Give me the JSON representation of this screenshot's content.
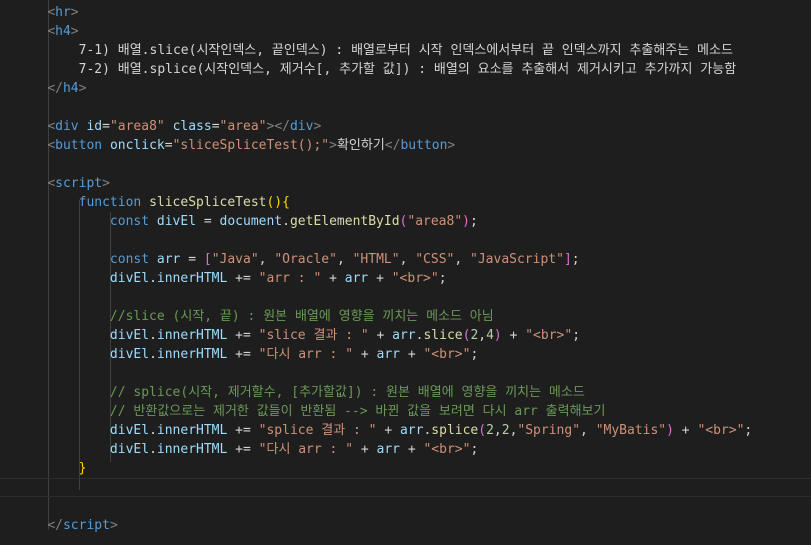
{
  "editor": {
    "colors": {
      "background": "#1e1e1e",
      "tag": "#569cd6",
      "punctuation": "#808080",
      "attribute": "#9cdcfe",
      "string": "#ce9178",
      "text": "#d4d4d4",
      "keyword": "#569cd6",
      "function": "#dcdcaa",
      "variable": "#9cdcfe",
      "number": "#b5cea8",
      "comment": "#6a9955",
      "brace": "#ffd700"
    },
    "lines": [
      {
        "indent": "    ",
        "tokens": [
          [
            "punc",
            "<"
          ],
          [
            "tag",
            "hr"
          ],
          [
            "punc",
            ">"
          ]
        ]
      },
      {
        "indent": "    ",
        "tokens": [
          [
            "punc",
            "<"
          ],
          [
            "tag",
            "h4"
          ],
          [
            "punc",
            ">"
          ]
        ]
      },
      {
        "indent": "        ",
        "tokens": [
          [
            "txt",
            "7-1) 배열.slice(시작인덱스, 끝인덱스) : 배열로부터 시작 인덱스에서부터 끝 인덱스까지 추출해주는 메소드"
          ]
        ]
      },
      {
        "indent": "        ",
        "tokens": [
          [
            "txt",
            "7-2) 배열.splice(시작인덱스, 제거수[, 추가할 값]) : 배열의 요소를 추출해서 제거시키고 추가까지 가능함"
          ]
        ]
      },
      {
        "indent": "    ",
        "tokens": [
          [
            "punc",
            "</"
          ],
          [
            "tag",
            "h4"
          ],
          [
            "punc",
            ">"
          ]
        ]
      },
      {
        "indent": "",
        "tokens": []
      },
      {
        "indent": "    ",
        "tokens": [
          [
            "punc",
            "<"
          ],
          [
            "tag",
            "div"
          ],
          [
            "txt",
            " "
          ],
          [
            "attr",
            "id"
          ],
          [
            "txt",
            "="
          ],
          [
            "str",
            "\"area8\""
          ],
          [
            "txt",
            " "
          ],
          [
            "attr",
            "class"
          ],
          [
            "txt",
            "="
          ],
          [
            "str",
            "\"area\""
          ],
          [
            "punc",
            "></"
          ],
          [
            "tag",
            "div"
          ],
          [
            "punc",
            ">"
          ]
        ]
      },
      {
        "indent": "    ",
        "tokens": [
          [
            "punc",
            "<"
          ],
          [
            "tag",
            "button"
          ],
          [
            "txt",
            " "
          ],
          [
            "attr",
            "onclick"
          ],
          [
            "txt",
            "="
          ],
          [
            "str",
            "\"sliceSpliceTest();\""
          ],
          [
            "punc",
            ">"
          ],
          [
            "txt",
            "확인하기"
          ],
          [
            "punc",
            "</"
          ],
          [
            "tag",
            "button"
          ],
          [
            "punc",
            ">"
          ]
        ]
      },
      {
        "indent": "",
        "tokens": []
      },
      {
        "indent": "    ",
        "tokens": [
          [
            "punc",
            "<"
          ],
          [
            "tag",
            "script"
          ],
          [
            "punc",
            ">"
          ]
        ]
      },
      {
        "indent": "        ",
        "tokens": [
          [
            "kw",
            "function"
          ],
          [
            "txt",
            " "
          ],
          [
            "fn",
            "sliceSpliceTest"
          ],
          [
            "brace",
            "()"
          ],
          [
            "brace",
            "{"
          ]
        ]
      },
      {
        "indent": "            ",
        "tokens": [
          [
            "kw",
            "const"
          ],
          [
            "txt",
            " "
          ],
          [
            "var",
            "divEl"
          ],
          [
            "op",
            " = "
          ],
          [
            "var",
            "document"
          ],
          [
            "op",
            "."
          ],
          [
            "fn",
            "getElementById"
          ],
          [
            "paren",
            "("
          ],
          [
            "str",
            "\"area8\""
          ],
          [
            "paren",
            ")"
          ],
          [
            "op",
            ";"
          ]
        ]
      },
      {
        "indent": "",
        "tokens": []
      },
      {
        "indent": "            ",
        "tokens": [
          [
            "kw",
            "const"
          ],
          [
            "txt",
            " "
          ],
          [
            "var",
            "arr"
          ],
          [
            "op",
            " = "
          ],
          [
            "paren",
            "["
          ],
          [
            "str",
            "\"Java\""
          ],
          [
            "op",
            ", "
          ],
          [
            "str",
            "\"Oracle\""
          ],
          [
            "op",
            ", "
          ],
          [
            "str",
            "\"HTML\""
          ],
          [
            "op",
            ", "
          ],
          [
            "str",
            "\"CSS\""
          ],
          [
            "op",
            ", "
          ],
          [
            "str",
            "\"JavaScript\""
          ],
          [
            "paren",
            "]"
          ],
          [
            "op",
            ";"
          ]
        ]
      },
      {
        "indent": "            ",
        "tokens": [
          [
            "var",
            "divEl"
          ],
          [
            "op",
            "."
          ],
          [
            "var",
            "innerHTML"
          ],
          [
            "op",
            " += "
          ],
          [
            "str",
            "\"arr : \""
          ],
          [
            "op",
            " + "
          ],
          [
            "var",
            "arr"
          ],
          [
            "op",
            " + "
          ],
          [
            "str",
            "\"<br>\""
          ],
          [
            "op",
            ";"
          ]
        ]
      },
      {
        "indent": "",
        "tokens": []
      },
      {
        "indent": "            ",
        "tokens": [
          [
            "cmt",
            "//slice (시작, 끝) : 원본 배열에 영향을 끼치는 메소드 아님"
          ]
        ]
      },
      {
        "indent": "            ",
        "tokens": [
          [
            "var",
            "divEl"
          ],
          [
            "op",
            "."
          ],
          [
            "var",
            "innerHTML"
          ],
          [
            "op",
            " += "
          ],
          [
            "str",
            "\"slice 결과 : \""
          ],
          [
            "op",
            " + "
          ],
          [
            "var",
            "arr"
          ],
          [
            "op",
            "."
          ],
          [
            "fn",
            "slice"
          ],
          [
            "paren",
            "("
          ],
          [
            "num",
            "2"
          ],
          [
            "op",
            ","
          ],
          [
            "num",
            "4"
          ],
          [
            "paren",
            ")"
          ],
          [
            "op",
            " + "
          ],
          [
            "str",
            "\"<br>\""
          ],
          [
            "op",
            ";"
          ]
        ]
      },
      {
        "indent": "            ",
        "tokens": [
          [
            "var",
            "divEl"
          ],
          [
            "op",
            "."
          ],
          [
            "var",
            "innerHTML"
          ],
          [
            "op",
            " += "
          ],
          [
            "str",
            "\"다시 arr : \""
          ],
          [
            "op",
            " + "
          ],
          [
            "var",
            "arr"
          ],
          [
            "op",
            " + "
          ],
          [
            "str",
            "\"<br>\""
          ],
          [
            "op",
            ";"
          ]
        ]
      },
      {
        "indent": "",
        "tokens": []
      },
      {
        "indent": "            ",
        "tokens": [
          [
            "cmt",
            "// splice(시작, 제거할수, [추가할값]) : 원본 배열에 영향을 끼치는 메소드"
          ]
        ]
      },
      {
        "indent": "            ",
        "tokens": [
          [
            "cmt",
            "// 반환값으로는 제거한 값들이 반환됨 --> 바뀐 값을 보려면 다시 arr 출력해보기"
          ]
        ]
      },
      {
        "indent": "            ",
        "tokens": [
          [
            "var",
            "divEl"
          ],
          [
            "op",
            "."
          ],
          [
            "var",
            "innerHTML"
          ],
          [
            "op",
            " += "
          ],
          [
            "str",
            "\"splice 결과 : \""
          ],
          [
            "op",
            " + "
          ],
          [
            "var",
            "arr"
          ],
          [
            "op",
            "."
          ],
          [
            "fn",
            "splice"
          ],
          [
            "paren",
            "("
          ],
          [
            "num",
            "2"
          ],
          [
            "op",
            ","
          ],
          [
            "num",
            "2"
          ],
          [
            "op",
            ","
          ],
          [
            "str",
            "\"Spring\""
          ],
          [
            "op",
            ", "
          ],
          [
            "str",
            "\"MyBatis\""
          ],
          [
            "paren",
            ")"
          ],
          [
            "op",
            " + "
          ],
          [
            "str",
            "\"<br>\""
          ],
          [
            "op",
            ";"
          ]
        ]
      },
      {
        "indent": "            ",
        "tokens": [
          [
            "var",
            "divEl"
          ],
          [
            "op",
            "."
          ],
          [
            "var",
            "innerHTML"
          ],
          [
            "op",
            " += "
          ],
          [
            "str",
            "\"다시 arr : \""
          ],
          [
            "op",
            " + "
          ],
          [
            "var",
            "arr"
          ],
          [
            "op",
            " + "
          ],
          [
            "str",
            "\"<br>\""
          ],
          [
            "op",
            ";"
          ]
        ]
      },
      {
        "indent": "        ",
        "tokens": [
          [
            "brace",
            "}"
          ]
        ]
      },
      {
        "indent": "",
        "tokens": []
      },
      {
        "indent": "",
        "tokens": []
      },
      {
        "indent": "    ",
        "tokens": [
          [
            "punc",
            "</"
          ],
          [
            "tag",
            "script"
          ],
          [
            "punc",
            ">"
          ]
        ]
      }
    ]
  }
}
